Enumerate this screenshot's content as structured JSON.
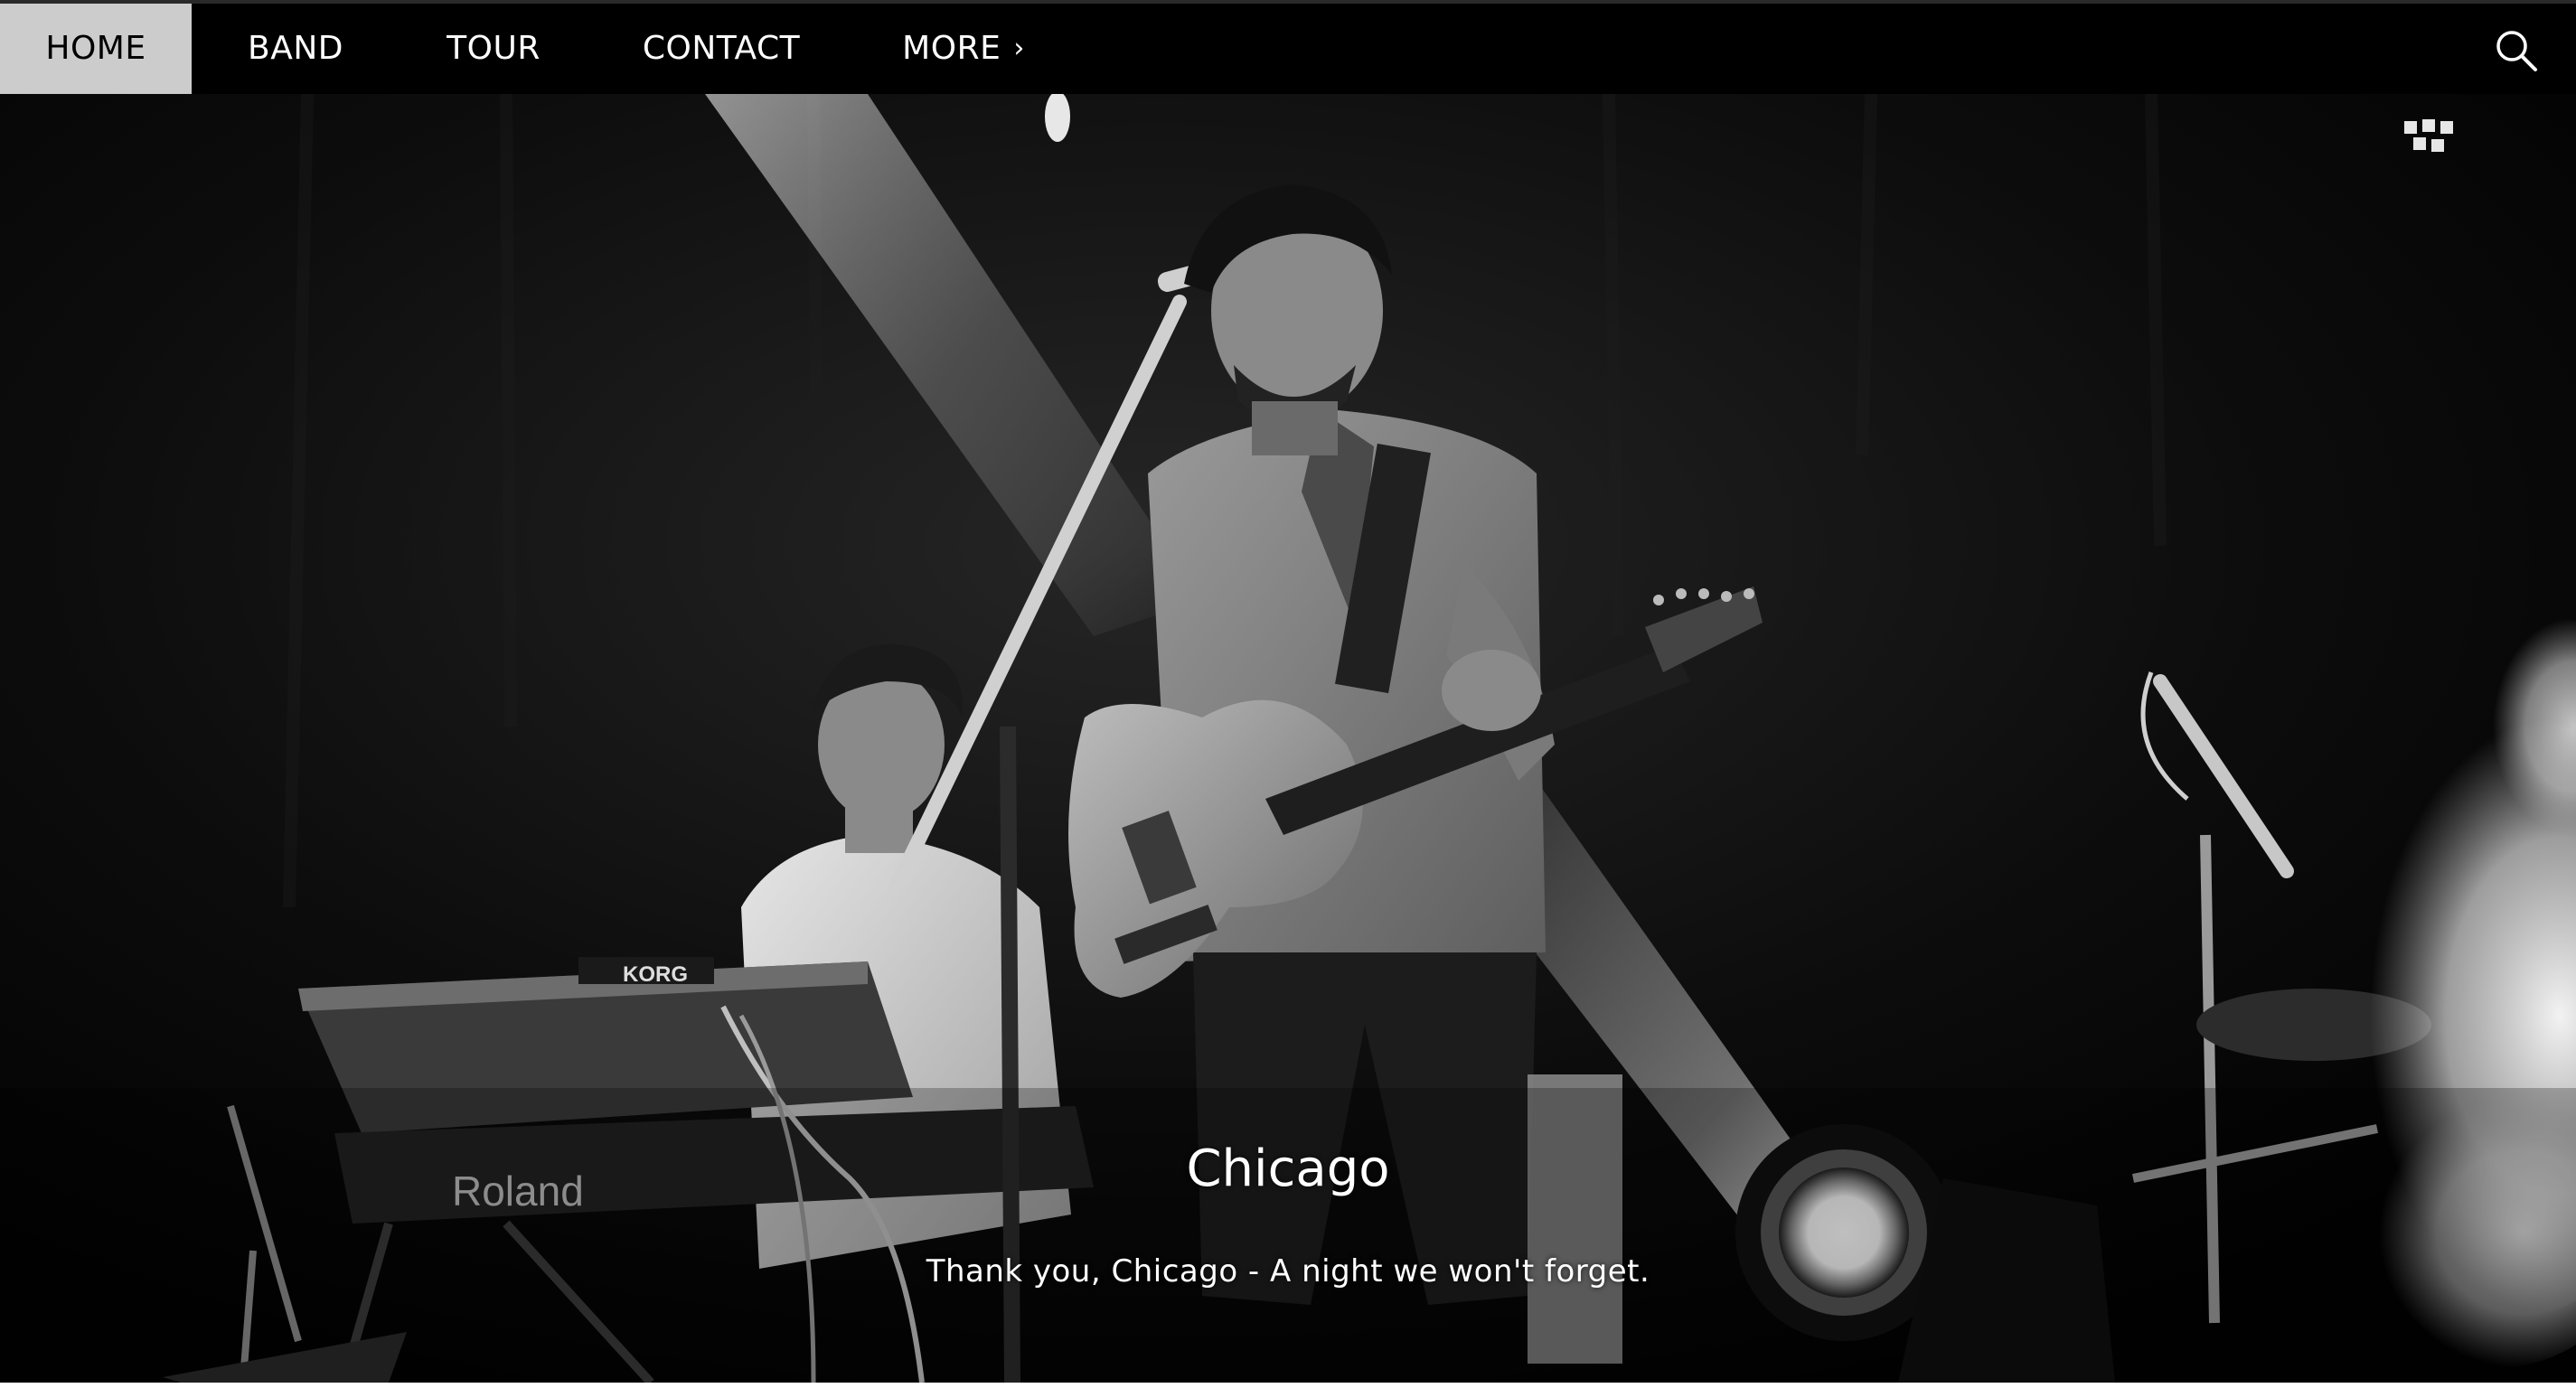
{
  "nav": {
    "items": [
      {
        "label": "HOME",
        "active": true
      },
      {
        "label": "BAND",
        "active": false
      },
      {
        "label": "TOUR",
        "active": false
      },
      {
        "label": "CONTACT",
        "active": false
      },
      {
        "label": "MORE",
        "active": false
      }
    ],
    "more_chevron": "›",
    "search_icon": "search-icon"
  },
  "hero": {
    "image_description": "black-and-white-concert-photo",
    "caption_title": "Chicago",
    "caption_text": "Thank you, Chicago - A night we won't forget.",
    "keyboard_brand": "KORG",
    "keyboard_brand_2": "Roland"
  },
  "colors": {
    "nav_background": "#000000",
    "nav_active_background": "#cccccc",
    "nav_text": "#ffffff",
    "nav_active_text": "#000000",
    "caption_text": "#ffffff"
  }
}
